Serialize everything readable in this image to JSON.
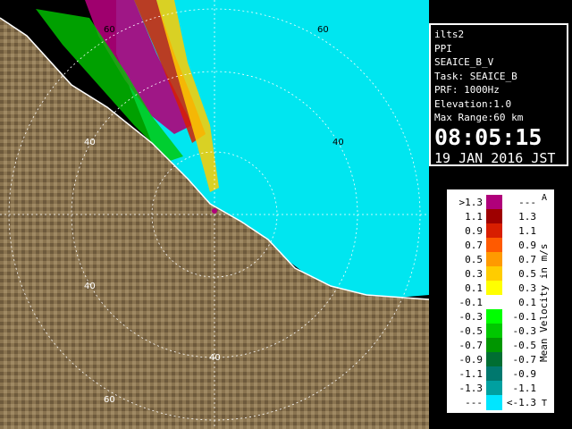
{
  "radar": {
    "range_labels_ne": [
      "60",
      "40"
    ],
    "range_labels_nw": [
      "60",
      "40"
    ],
    "range_labels_sw": [
      "40",
      "40",
      "60"
    ],
    "range_labels_s": [
      "40"
    ]
  },
  "info": {
    "site": "ilts2",
    "mode": "PPI",
    "product": "SEAICE_B_V",
    "task": "Task: SEAICE_B",
    "prf": "PRF: 1000Hz",
    "elevation": "Elevation:1.0",
    "max_range": "Max Range:60 km",
    "time": "08:05:15",
    "date": "19 JAN 2016 JST"
  },
  "legend": {
    "unit": "Mean Velocity in m/s",
    "top_cap": "A",
    "bottom_cap": "T",
    "rows": [
      {
        "lo": ">1.3",
        "hi": "---",
        "color": "#b0007a"
      },
      {
        "lo": "1.1",
        "hi": "1.3",
        "color": "#9e0000"
      },
      {
        "lo": "0.9",
        "hi": "1.1",
        "color": "#d81e00"
      },
      {
        "lo": "0.7",
        "hi": "0.9",
        "color": "#ff5a00"
      },
      {
        "lo": "0.5",
        "hi": "0.7",
        "color": "#ff9a00"
      },
      {
        "lo": "0.3",
        "hi": "0.5",
        "color": "#ffcc00"
      },
      {
        "lo": "0.1",
        "hi": "0.3",
        "color": "#ffff00"
      },
      {
        "lo": "-0.1",
        "hi": "0.1",
        "color": "#ffffff"
      },
      {
        "lo": "-0.3",
        "hi": "-0.1",
        "color": "#00ff00"
      },
      {
        "lo": "-0.5",
        "hi": "-0.3",
        "color": "#00c800"
      },
      {
        "lo": "-0.7",
        "hi": "-0.5",
        "color": "#009600"
      },
      {
        "lo": "-0.9",
        "hi": "-0.7",
        "color": "#006e32"
      },
      {
        "lo": "-1.1",
        "hi": "-0.9",
        "color": "#00786e"
      },
      {
        "lo": "-1.3",
        "hi": "-1.1",
        "color": "#00a0a0"
      },
      {
        "lo": "---",
        "hi": "<-1.3",
        "color": "#00e6ff"
      }
    ]
  }
}
